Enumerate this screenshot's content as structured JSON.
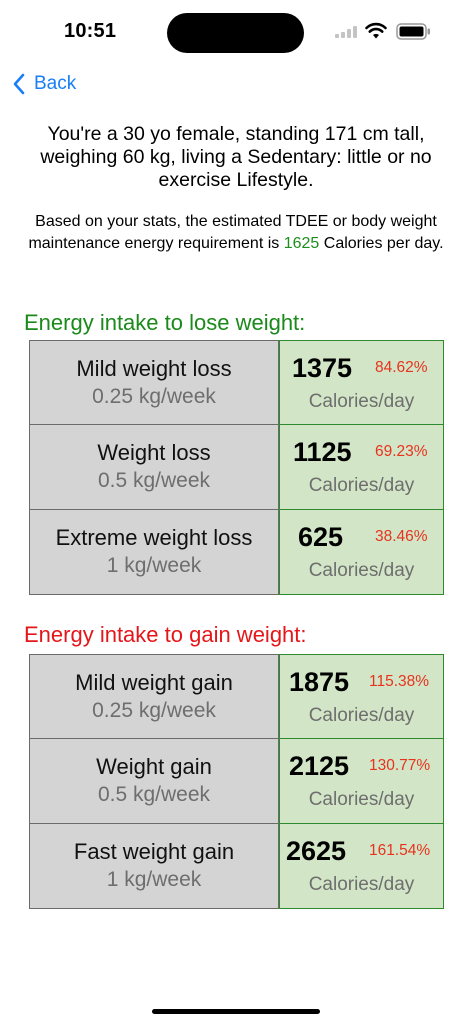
{
  "status_bar": {
    "time": "10:51"
  },
  "nav": {
    "back_label": "Back"
  },
  "summary": "You're a 30 yo female, standing 171 cm tall, weighing 60 kg, living a Sedentary: little or no exercise Lifestyle.",
  "tdee": {
    "prefix": "Based on your stats, the estimated TDEE or body weight maintenance energy requirement is",
    "value": "1625",
    "suffix": "Calories per day."
  },
  "lose": {
    "title": "Energy intake to lose weight:",
    "rows": [
      {
        "name": "Mild weight loss",
        "rate": "0.25 kg/week",
        "kcal": "1375",
        "pct": "84.62%",
        "unit": "Calories/day"
      },
      {
        "name": "Weight loss",
        "rate": "0.5 kg/week",
        "kcal": "1125",
        "pct": "69.23%",
        "unit": "Calories/day"
      },
      {
        "name": "Extreme weight loss",
        "rate": "1 kg/week",
        "kcal": "625",
        "pct": "38.46%",
        "unit": "Calories/day"
      }
    ]
  },
  "gain": {
    "title": "Energy intake to gain weight:",
    "rows": [
      {
        "name": "Mild weight gain",
        "rate": "0.25 kg/week",
        "kcal": "1875",
        "pct": "115.38%",
        "unit": "Calories/day"
      },
      {
        "name": "Weight gain",
        "rate": "0.5 kg/week",
        "kcal": "2125",
        "pct": "130.77%",
        "unit": "Calories/day"
      },
      {
        "name": "Fast weight gain",
        "rate": "1 kg/week",
        "kcal": "2625",
        "pct": "161.54%",
        "unit": "Calories/day"
      }
    ]
  },
  "colors": {
    "accent": "#1a7ef7",
    "lose": "#1a8a1a",
    "gain": "#e5161a",
    "percent": "#e8321e",
    "calorie_cell": "#d2e6c7"
  },
  "icons": {
    "back": "chevron-left-icon",
    "signal": "cellular-signal-icon",
    "wifi": "wifi-icon",
    "battery": "battery-icon"
  }
}
